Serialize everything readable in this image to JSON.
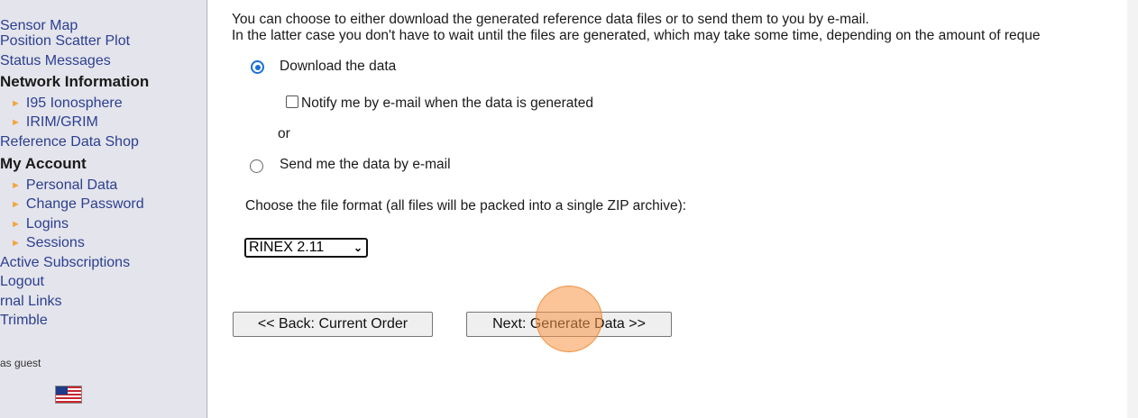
{
  "sidebar": {
    "items": [
      {
        "label": "Sensor Map"
      },
      {
        "label": "Position Scatter Plot"
      },
      {
        "label": "Status Messages"
      },
      {
        "label": "Network Information"
      },
      {
        "label": "I95 Ionosphere"
      },
      {
        "label": "IRIM/GRIM"
      },
      {
        "label": "Reference Data Shop"
      },
      {
        "label": "My Account"
      },
      {
        "label": "Personal Data"
      },
      {
        "label": "Change Password"
      },
      {
        "label": "Logins"
      },
      {
        "label": "Sessions"
      },
      {
        "label": "Active Subscriptions"
      },
      {
        "label": "Logout"
      },
      {
        "label": "rnal Links"
      },
      {
        "label": "Trimble"
      }
    ],
    "guest_label": "as guest",
    "flag_icon": "us-flag-icon"
  },
  "main": {
    "intro_line1": "You can choose to either download the generated reference data files or to send them to you by e-mail.",
    "intro_line2": "In the latter case you don't have to wait until the files are generated, which may take some time, depending on the amount of reque",
    "option_download": "Download the data",
    "notify_label": "Notify me by e-mail when the data is generated",
    "or_label": "or",
    "option_email": "Send me the data by e-mail",
    "format_prompt": "Choose the file format (all files will be packed into a single ZIP archive):",
    "format_selected": "RINEX 2.11",
    "back_button": "<< Back: Current Order",
    "next_button": "Next: Generate Data >>"
  },
  "colors": {
    "link": "#2b3f8f",
    "accent": "#1a6fd6",
    "highlight": "#f79646"
  }
}
